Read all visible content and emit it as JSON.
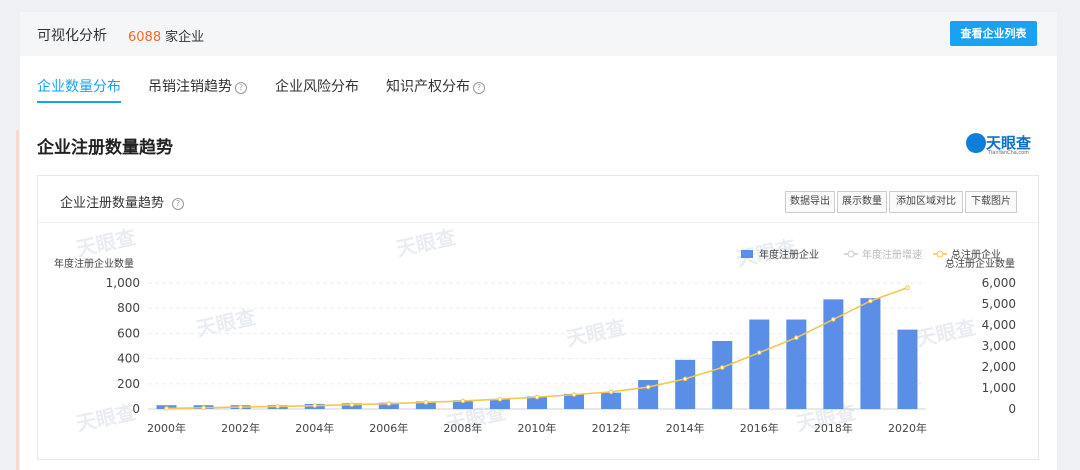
{
  "header": {
    "title": "可视化分析",
    "company_count": "6088",
    "company_suffix": "家企业",
    "list_button": "查看企业列表"
  },
  "tabs": [
    {
      "label": "企业数量分布",
      "help": false,
      "active": true
    },
    {
      "label": "吊销注销趋势",
      "help": true,
      "active": false
    },
    {
      "label": "企业风险分布",
      "help": false,
      "active": false
    },
    {
      "label": "知识产权分布",
      "help": true,
      "active": false
    }
  ],
  "section": {
    "title": "企业注册数量趋势",
    "logo_text": "天眼查",
    "logo_sub": "TianYanCha.com"
  },
  "card": {
    "title": "企业注册数量趋势",
    "tools": [
      "数据导出",
      "展示数量",
      "添加区域对比",
      "下载图片"
    ]
  },
  "chart_data": {
    "type": "bar",
    "categories": [
      "2000年",
      "2001年",
      "2002年",
      "2003年",
      "2004年",
      "2005年",
      "2006年",
      "2007年",
      "2008年",
      "2009年",
      "2010年",
      "2011年",
      "2012年",
      "2013年",
      "2014年",
      "2015年",
      "2016年",
      "2017年",
      "2018年",
      "2019年",
      "2020年"
    ],
    "tick_labels": [
      "2000年",
      "2002年",
      "2004年",
      "2006年",
      "2008年",
      "2010年",
      "2012年",
      "2014年",
      "2016年",
      "2018年",
      "2020年"
    ],
    "series": [
      {
        "name": "年度注册企业",
        "kind": "bar",
        "axis": "left",
        "color": "#5b8ee6",
        "values": [
          30,
          30,
          30,
          30,
          40,
          45,
          50,
          60,
          70,
          80,
          100,
          120,
          130,
          230,
          390,
          540,
          710,
          710,
          870,
          880,
          630
        ]
      },
      {
        "name": "年度注册增速",
        "kind": "line",
        "axis": "none",
        "color": "#c8ccd2",
        "values": []
      },
      {
        "name": "总注册企业",
        "kind": "line",
        "axis": "right",
        "color": "#f3c74a",
        "values": [
          30,
          60,
          90,
          120,
          160,
          205,
          255,
          315,
          385,
          465,
          565,
          685,
          815,
          1045,
          1435,
          1975,
          2685,
          3395,
          4265,
          5145,
          5775
        ]
      }
    ],
    "ylabel_left": "年度注册企业数量",
    "ylabel_right": "总注册企业数量",
    "ylim_left": [
      0,
      1000
    ],
    "yticks_left": [
      "0",
      "200",
      "400",
      "600",
      "800",
      "1,000"
    ],
    "ylim_right": [
      0,
      6000
    ],
    "yticks_right": [
      "0",
      "1,000",
      "2,000",
      "3,000",
      "4,000",
      "5,000",
      "6,000"
    ],
    "legend_position": "top-right",
    "grid": true,
    "watermark": "天眼查"
  }
}
